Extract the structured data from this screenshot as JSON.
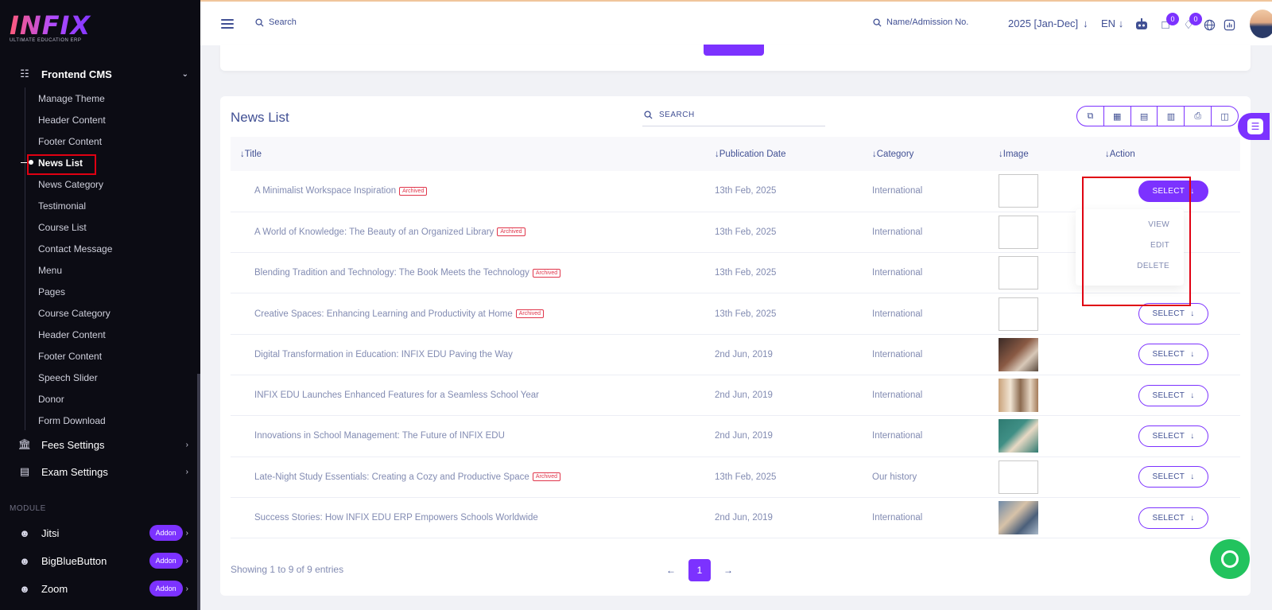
{
  "brand": {
    "logo": "INFIX",
    "tagline": "ULTIMATE EDUCATION ERP"
  },
  "sidebar": {
    "section": "Frontend CMS",
    "items": [
      {
        "label": "Manage Theme"
      },
      {
        "label": "Header Content"
      },
      {
        "label": "Footer Content"
      },
      {
        "label": "News List"
      },
      {
        "label": "News Category"
      },
      {
        "label": "Testimonial"
      },
      {
        "label": "Course List"
      },
      {
        "label": "Contact Message"
      },
      {
        "label": "Menu"
      },
      {
        "label": "Pages"
      },
      {
        "label": "Course Category"
      },
      {
        "label": "Header Content"
      },
      {
        "label": "Footer Content"
      },
      {
        "label": "Speech Slider"
      },
      {
        "label": "Donor"
      },
      {
        "label": "Form Download"
      }
    ],
    "groups": [
      {
        "label": "Fees Settings"
      },
      {
        "label": "Exam Settings"
      }
    ],
    "module_label": "MODULE",
    "modules": [
      {
        "label": "Jitsi",
        "badge": "Addon"
      },
      {
        "label": "BigBlueButton",
        "badge": "Addon"
      },
      {
        "label": "Zoom",
        "badge": "Addon"
      }
    ]
  },
  "topbar": {
    "search_placeholder": "Search",
    "student_search_placeholder": "Name/Admission No.",
    "session": "2025 [Jan-Dec]",
    "language": "EN",
    "chat_count": "0",
    "notification_count": "0"
  },
  "news": {
    "title": "News List",
    "search_placeholder": "SEARCH",
    "columns": {
      "title": "Title",
      "date": "Publication Date",
      "category": "Category",
      "image": "Image",
      "action": "Action"
    },
    "archived_label": "Archived",
    "select_label": "SELECT",
    "rows": [
      {
        "title": "A Minimalist Workspace Inspiration",
        "archived": true,
        "date": "13th Feb, 2025",
        "category": "International",
        "image": "none"
      },
      {
        "title": "A World of Knowledge: The Beauty of an Organized Library",
        "archived": true,
        "date": "13th Feb, 2025",
        "category": "International",
        "image": "none"
      },
      {
        "title": "Blending Tradition and Technology: The Book Meets the Technology",
        "archived": true,
        "date": "13th Feb, 2025",
        "category": "International",
        "image": "none"
      },
      {
        "title": "Creative Spaces: Enhancing Learning and Productivity at Home",
        "archived": true,
        "date": "13th Feb, 2025",
        "category": "International",
        "image": "none"
      },
      {
        "title": "Digital Transformation in Education: INFIX EDU Paving the Way",
        "archived": false,
        "date": "2nd Jun, 2019",
        "category": "International",
        "image": "photo-1"
      },
      {
        "title": "INFIX EDU Launches Enhanced Features for a Seamless School Year",
        "archived": false,
        "date": "2nd Jun, 2019",
        "category": "International",
        "image": "photo-2"
      },
      {
        "title": "Innovations in School Management: The Future of INFIX EDU",
        "archived": false,
        "date": "2nd Jun, 2019",
        "category": "International",
        "image": "photo-3"
      },
      {
        "title": "Late-Night Study Essentials: Creating a Cozy and Productive Space",
        "archived": true,
        "date": "13th Feb, 2025",
        "category": "Our history",
        "image": "none"
      },
      {
        "title": "Success Stories: How INFIX EDU ERP Empowers Schools Worldwide",
        "archived": false,
        "date": "2nd Jun, 2019",
        "category": "International",
        "image": "photo-4"
      }
    ],
    "dropdown": {
      "view": "VIEW",
      "edit": "EDIT",
      "delete": "DELETE"
    },
    "footer_info": "Showing 1 to 9 of 9 entries",
    "current_page": "1"
  },
  "colors": {
    "accent": "#7c32ff",
    "sidebar_bg": "#0c0c14",
    "highlight": "#e00012",
    "whatsapp": "#22c35e"
  }
}
